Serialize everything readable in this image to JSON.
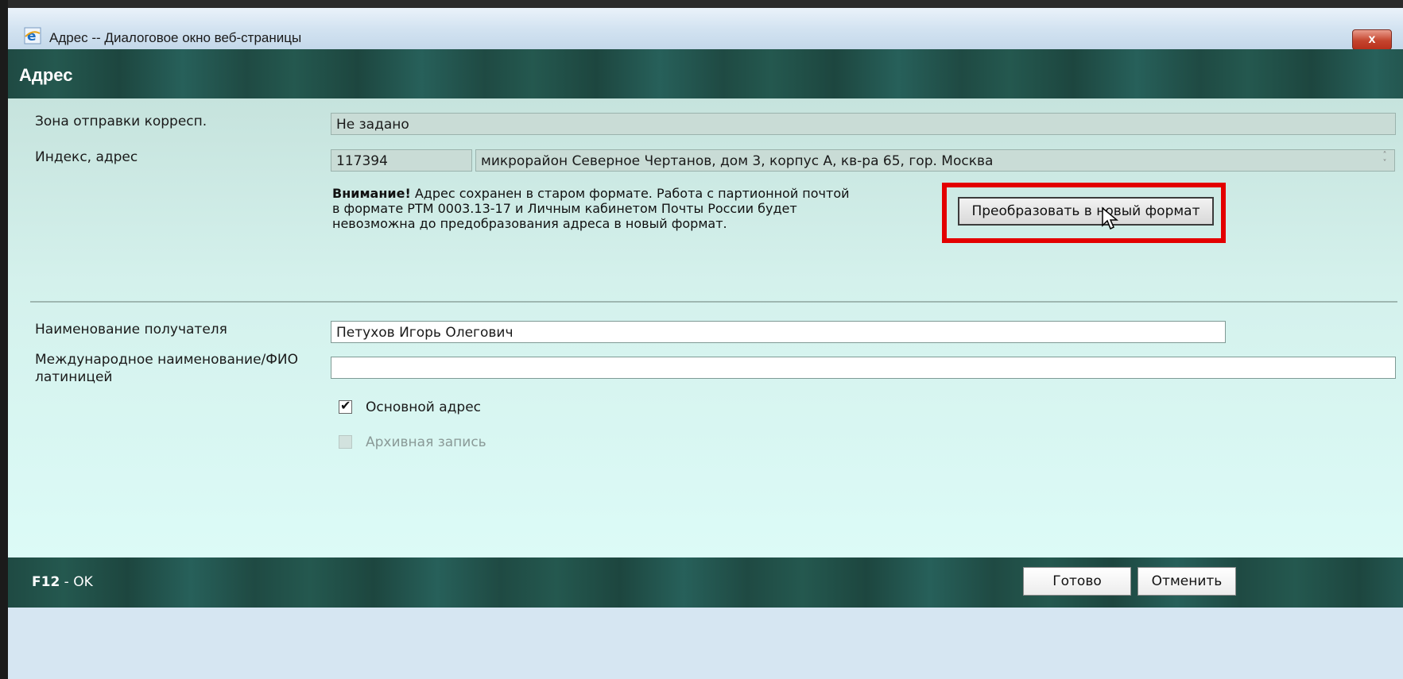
{
  "window": {
    "title": "Адрес -- Диалоговое окно веб-страницы",
    "close_label": "x"
  },
  "header": {
    "title": "Адрес"
  },
  "form": {
    "zone_label": "Зона отправки корресп.",
    "zone_value": "Не задано",
    "address_label": "Индекс, адрес",
    "postal_index": "117394",
    "address_value": "микрорайон Северное Чертанов, дом 3, корпус А, кв-ра 65, гор. Москва",
    "warning_bold": "Внимание!",
    "warning_line1": " Адрес сохранен в старом формате. Работа с партионной почтой",
    "warning_line2": "в формате РТМ 0003.13-17 и Личным кабинетом Почты России будет",
    "warning_line3": "невозможна до предобразования адреса в новый формат.",
    "convert_button": "Преобразовать в новый формат",
    "recipient_label": "Наименование получателя",
    "recipient_value": "Петухов Игорь Олегович",
    "intl_label_line1": "Международное наименование/ФИО",
    "intl_label_line2": "латиницей",
    "intl_value": "",
    "main_address_label": "Основной адрес",
    "main_address_checked": true,
    "archive_label": "Архивная запись",
    "archive_checked": false
  },
  "footer": {
    "hint_key": "F12",
    "hint_text": " - OK",
    "done_button": "Готово",
    "cancel_button": "Отменить"
  },
  "colors": {
    "accent_green": "#1f4a43",
    "highlight_red": "#e30000"
  }
}
